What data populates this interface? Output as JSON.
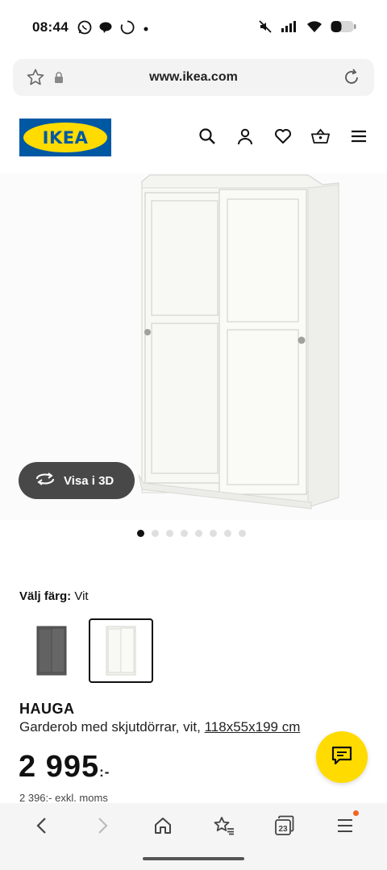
{
  "status_bar": {
    "time": "08:44",
    "left_icons": [
      "whatsapp-icon",
      "chat-bubble-icon",
      "sync-circle-icon",
      "dot-icon"
    ],
    "right_icons": [
      "mute-icon",
      "signal-icon",
      "wifi-icon",
      "battery-icon"
    ]
  },
  "browser": {
    "url": "www.ikea.com",
    "star_icon": "star-outline-icon",
    "lock_icon": "lock-icon",
    "reload_icon": "reload-icon"
  },
  "header": {
    "logo_text": "IKEA",
    "logo_colors": {
      "blue": "#0058a3",
      "yellow": "#ffdb00"
    },
    "icons": [
      "search-icon",
      "user-icon",
      "heart-icon",
      "basket-icon",
      "menu-icon"
    ]
  },
  "gallery": {
    "view_3d_label": "Visa i 3D",
    "image_count": 8,
    "active_index": 0
  },
  "color_picker": {
    "label": "Välj färg:",
    "value": "Vit",
    "options": [
      {
        "name": "dark-grey",
        "color": "#5a5a5a",
        "selected": false
      },
      {
        "name": "white",
        "color": "#f4f4f2",
        "selected": true
      }
    ]
  },
  "product": {
    "name": "HAUGA",
    "description": "Garderob med skjutdörrar, vit,",
    "dimensions": "118x55x199 cm",
    "price": "2 995",
    "price_suffix": ":-",
    "price_ex_vat": "2 396:- exkl. moms"
  },
  "chat": {
    "icon": "chat-icon",
    "color": "#ffdb00"
  },
  "bottom_nav": {
    "tab_count": "23",
    "icons": [
      "back-icon",
      "forward-icon",
      "home-icon",
      "bookmarks-icon",
      "tabs-icon",
      "menu-icon"
    ]
  }
}
